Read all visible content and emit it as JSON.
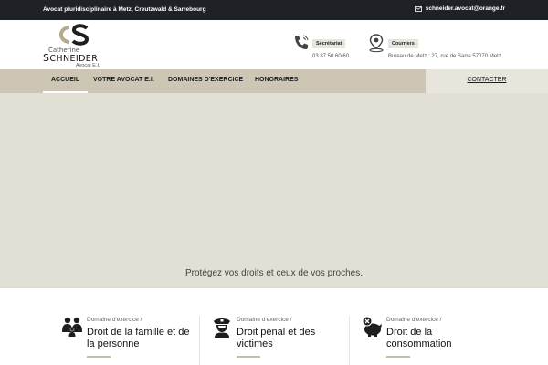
{
  "topbar": {
    "tagline": "Avocat pluridisciplinaire à Metz, Creutzwald & Sarrebourg",
    "email": "schneider.avocat@orange.fr",
    "email_icon": "envelope-icon"
  },
  "logo": {
    "monogram": "CS",
    "first_name": "Catherine",
    "last_name_initial": "S",
    "last_name_rest": "CHNEIDER",
    "title": "Avocat E.I."
  },
  "contacts": [
    {
      "icon": "phone-icon",
      "label": "Secrétariat",
      "text": "03 87 50 60 60"
    },
    {
      "icon": "map-pin-icon",
      "label": "Courriers",
      "text": "Bureau de Metz : 27, rue de Sarre 57070 Metz"
    }
  ],
  "nav": {
    "items": [
      {
        "label": "ACCUEIL"
      },
      {
        "label": "VOTRE AVOCAT E.I."
      },
      {
        "label": "DOMAINES D'EXERCICE"
      },
      {
        "label": "HONORAIRES"
      }
    ],
    "cta": "CONTACTER"
  },
  "hero": {
    "slogan": "Protégez vos droits et ceux de vos proches."
  },
  "domains": [
    {
      "icon": "family-icon",
      "prefix": "Domaine d'exercice /",
      "name": "Droit de la famille et de la personne"
    },
    {
      "icon": "police-officer-icon",
      "prefix": "Domaine d'exercice /",
      "name": "Droit pénal et des victimes"
    },
    {
      "icon": "piggy-bank-icon",
      "prefix": "Domaine d'exercice /",
      "name": "Droit de la consommation"
    }
  ],
  "colors": {
    "topbar": "#1e2226",
    "nav": "#cdc6b5",
    "hero": "#e2dfd5",
    "accent": "#c5bea9"
  }
}
